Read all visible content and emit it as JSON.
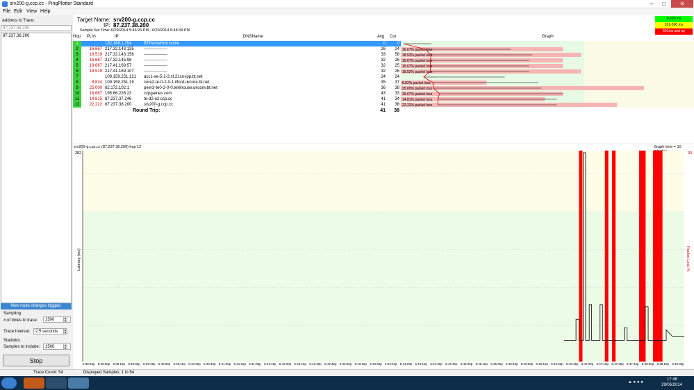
{
  "window": {
    "title": "srv200-g.ccp.cc - PingPlotter Standard"
  },
  "menu": [
    "File",
    "Edit",
    "View",
    "Help"
  ],
  "left": {
    "address_label": "Address to Trace:",
    "address_value": "87.237.38.200",
    "history": [
      "87.237.38.200"
    ],
    "route_changes": "New route changes logged.",
    "sampling_label": "Sampling",
    "times_label": "# of times to trace:",
    "times_value": "1500",
    "interval_label": "Trace Interval:",
    "interval_value": "2.5 seconds",
    "statistics_label": "Statistics",
    "samples_label": "Samples to include:",
    "samples_value": "1500",
    "stop_label": "Stop"
  },
  "target": {
    "name_label": "Target Name:",
    "name": "srv200-g.ccp.cc",
    "ip_label": "IP:",
    "ip": "87.237.38.200",
    "sample_time": "Sample Set Time:  6/29/2014 5:46:26 PM - 6/29/2014 5:48:39 PM"
  },
  "legend": [
    {
      "label": "0-200 ms",
      "color": "#00ff00"
    },
    {
      "label": "201-500 ms",
      "color": "#ffff00"
    },
    {
      "label": "501ms and up",
      "color": "#ff0000"
    }
  ],
  "columns": {
    "hop": "Hop",
    "pl": "PL%",
    "ip": "IP",
    "dns": "DNSName",
    "avg": "Avg",
    "cur": "Cur",
    "graph": "Graph"
  },
  "hops": [
    {
      "hop": "1",
      "pl": "",
      "ip": "192.168.1.254",
      "dns": "BTHomeHub.home",
      "avg": "0",
      "cur": "0",
      "loss": "",
      "loss_pct": 0,
      "selected": true
    },
    {
      "hop": "2",
      "pl": "16.667",
      "ip": "217.32.143.135",
      "dns": "-----------------",
      "avg": "26",
      "cur": "24",
      "loss": "16.67% packet loss",
      "loss_pct": 16.67
    },
    {
      "hop": "3",
      "pl": "18.519",
      "ip": "217.32.143.158",
      "dns": "-----------------",
      "avg": "33",
      "cur": "58",
      "loss": "18.52% packet loss",
      "loss_pct": 18.52
    },
    {
      "hop": "4",
      "pl": "16.667",
      "ip": "217.32.145.98",
      "dns": "-----------------",
      "avg": "32",
      "cur": "26",
      "loss": "16.67% packet loss",
      "loss_pct": 16.67
    },
    {
      "hop": "5",
      "pl": "16.667",
      "ip": "217.41.169.57",
      "dns": "-----------------",
      "avg": "32",
      "cur": "25",
      "loss": "16.67% packet loss",
      "loss_pct": 16.67
    },
    {
      "hop": "6",
      "pl": "18.519",
      "ip": "217.41.169.107",
      "dns": "-----------------",
      "avg": "32",
      "cur": "26",
      "loss": "18.52% packet loss",
      "loss_pct": 18.52
    },
    {
      "hop": "7",
      "pl": "",
      "ip": "109.159.251.121",
      "dns": "acc1-xe-5-2-3.sf.21cn-ipp.bt.net",
      "avg": "24",
      "cur": "24",
      "loss": "",
      "loss_pct": 0
    },
    {
      "hop": "8",
      "pl": "8.824",
      "ip": "109.159.251.19",
      "dns": "core2-te-0-2-0-1.ilford.ukcore.bt.net",
      "avg": "35",
      "cur": "37",
      "loss": "8.82% packet loss",
      "loss_pct": 8.82
    },
    {
      "hop": "9",
      "pl": "25.000",
      "ip": "62.172.102.1",
      "dns": "peer3-te0-3-0-0.telehouse.ukcore.bt.net",
      "avg": "36",
      "cur": "38",
      "loss": "25.00% packet loss",
      "loss_pct": 25.0
    },
    {
      "hop": "10",
      "pl": "16.667",
      "ip": "195.66.226.23",
      "dns": "ccpgames.com",
      "avg": "43",
      "cur": "33",
      "loss": "16.67% packet loss",
      "loss_pct": 16.67
    },
    {
      "hop": "11",
      "pl": "14.815",
      "ip": "87.237.37.246",
      "dns": "te-d2-e2.ccp.cc",
      "avg": "41",
      "cur": "34",
      "loss": "14.81% packet loss",
      "loss_pct": 14.81
    },
    {
      "hop": "12",
      "pl": "22.222",
      "ip": "87.237.38.200",
      "dns": "srv200-g.ccp.cc",
      "avg": "41",
      "cur": "38",
      "loss": "22.22% packet loss",
      "loss_pct": 22.22
    }
  ],
  "roundtrip": {
    "label": "Round Trip:",
    "avg": "41",
    "cur": "38"
  },
  "bottom": {
    "title": "srv200-g.ccp.cc (87.237.38.200) hop 12",
    "graph_time": "Graph time = 10 minutes",
    "y_label": "Latency (ms)",
    "y2_label": "Packet Loss %",
    "y_max": "282",
    "y2_max": "30"
  },
  "timeline": {
    "ticks": [
      "5:38:45p",
      "5:39:00p",
      "5:39:15p",
      "5:39:30p",
      "5:39:45p",
      "5:40:00p",
      "5:40:15p",
      "5:40:30p",
      "5:40:45p",
      "5:41:00p",
      "5:41:15p",
      "5:41:30p",
      "5:41:45p",
      "5:42:00p",
      "5:42:15p",
      "5:42:30p",
      "5:42:45p",
      "5:43:00p",
      "5:43:15p",
      "5:43:30p",
      "5:43:45p",
      "5:44:00p",
      "5:44:15p",
      "5:44:30p",
      "5:44:45p",
      "5:45:00p",
      "5:45:15p",
      "5:45:30p",
      "5:45:45p",
      "5:46:00p",
      "5:46:15p",
      "5:46:30p",
      "5:46:45p",
      "5:47:00p",
      "5:47:15p",
      "5:47:30p",
      "5:47:45p",
      "5:48:00p",
      "5:48:15p",
      "5:48:30p"
    ],
    "loss_bars": [
      0.825,
      0.868,
      0.88,
      0.925,
      0.93,
      0.948,
      0.953,
      0.958
    ]
  },
  "status": {
    "trace_count": "Trace Count: 54",
    "displayed": "Displayed Samples: 1 to 54"
  },
  "clock": {
    "time": "17:48",
    "date": "29/06/2014"
  }
}
